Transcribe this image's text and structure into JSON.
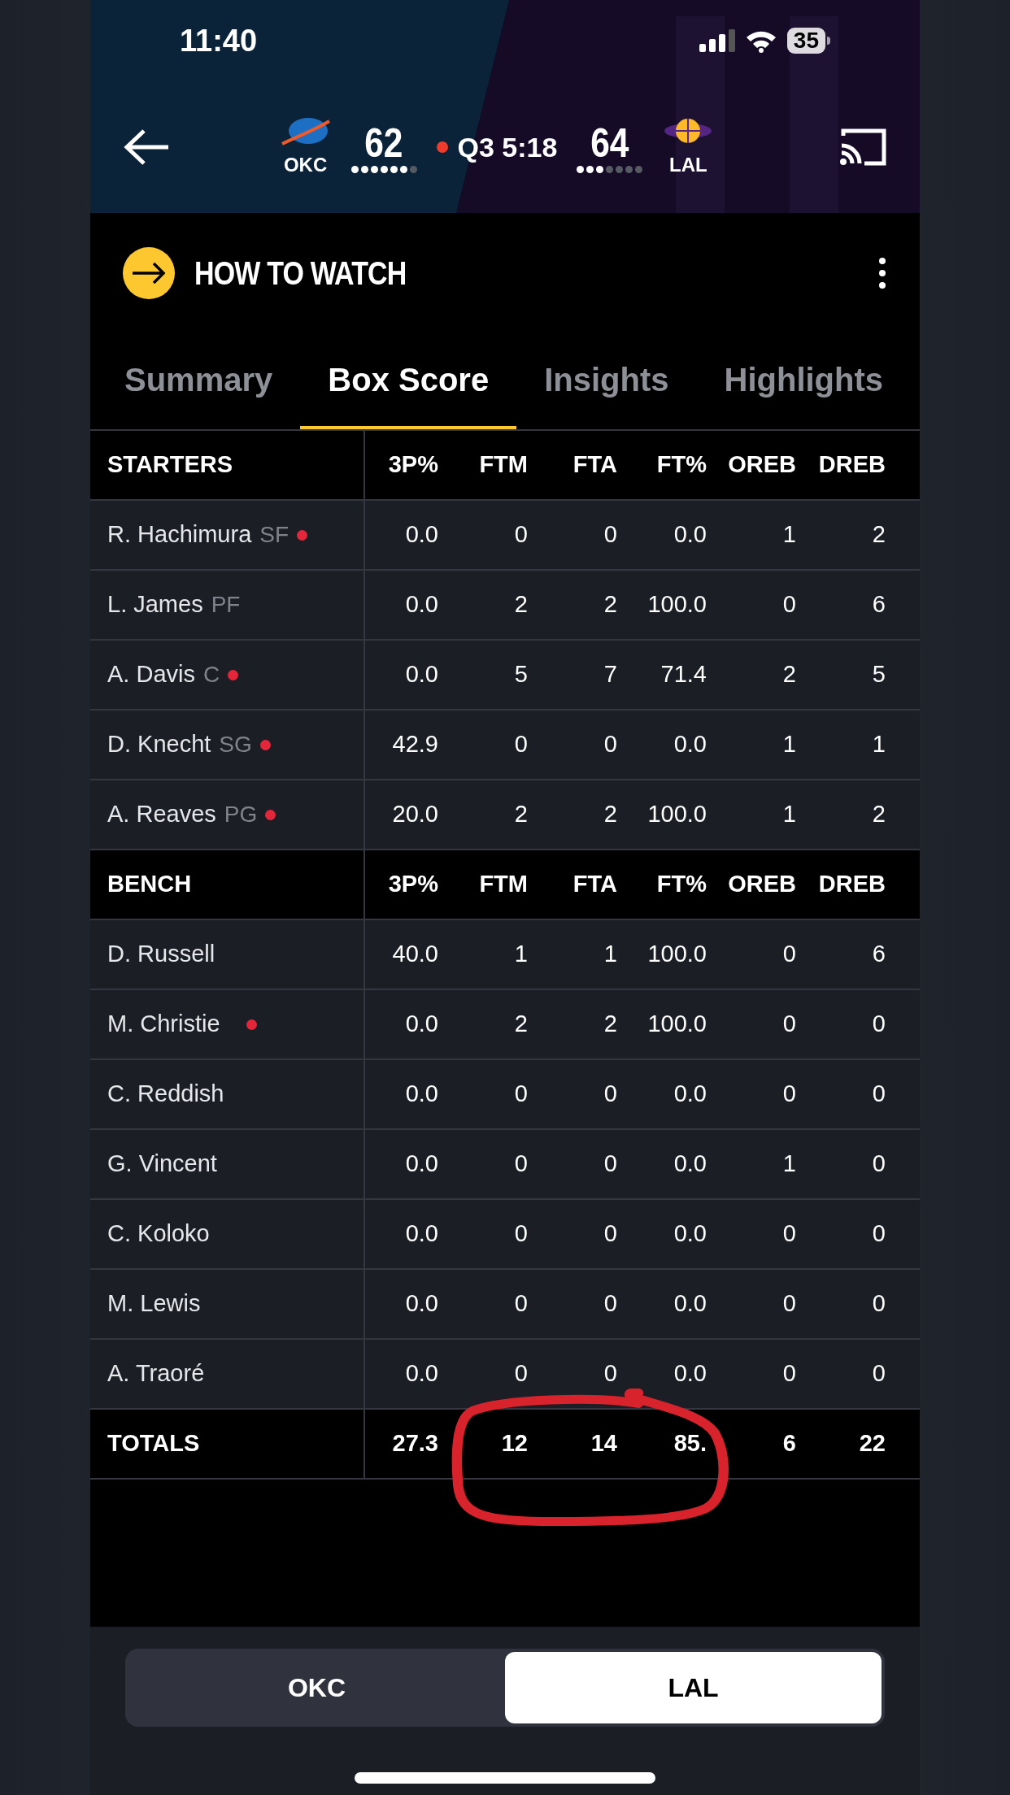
{
  "status_bar": {
    "time": "11:40",
    "battery": "35"
  },
  "scoreboard": {
    "away": {
      "abbr": "OKC",
      "score": "62",
      "timeouts": [
        {
          "remaining": true
        },
        {
          "remaining": true
        },
        {
          "remaining": true
        },
        {
          "remaining": true
        },
        {
          "remaining": true
        },
        {
          "remaining": true
        },
        {
          "remaining": false
        }
      ]
    },
    "home": {
      "abbr": "LAL",
      "score": "64",
      "timeouts": [
        {
          "remaining": true
        },
        {
          "remaining": true
        },
        {
          "remaining": true
        },
        {
          "remaining": false
        },
        {
          "remaining": false
        },
        {
          "remaining": false
        },
        {
          "remaining": false
        }
      ]
    },
    "live": true,
    "clock": "Q3 5:18"
  },
  "banner": {
    "title": "HOW TO WATCH"
  },
  "tabs": [
    {
      "label": "Summary",
      "selected": false
    },
    {
      "label": "Box Score",
      "selected": true
    },
    {
      "label": "Insights",
      "selected": false
    },
    {
      "label": "Highlights",
      "selected": false
    }
  ],
  "sections": [
    {
      "title": "STARTERS",
      "columns": [
        "3P%",
        "FTM",
        "FTA",
        "FT%",
        "OREB",
        "DREB"
      ],
      "rows": [
        {
          "name": "R. Hachimura",
          "position": "SF",
          "on_court": true,
          "stats": [
            "0.0",
            "0",
            "0",
            "0.0",
            "1",
            "2"
          ]
        },
        {
          "name": "L. James",
          "position": "PF",
          "on_court": false,
          "stats": [
            "0.0",
            "2",
            "2",
            "100.0",
            "0",
            "6"
          ]
        },
        {
          "name": "A. Davis",
          "position": "C",
          "on_court": true,
          "stats": [
            "0.0",
            "5",
            "7",
            "71.4",
            "2",
            "5"
          ]
        },
        {
          "name": "D. Knecht",
          "position": "SG",
          "on_court": true,
          "stats": [
            "42.9",
            "0",
            "0",
            "0.0",
            "1",
            "1"
          ]
        },
        {
          "name": "A. Reaves",
          "position": "PG",
          "on_court": true,
          "stats": [
            "20.0",
            "2",
            "2",
            "100.0",
            "1",
            "2"
          ]
        }
      ]
    },
    {
      "title": "BENCH",
      "columns": [
        "3P%",
        "FTM",
        "FTA",
        "FT%",
        "OREB",
        "DREB"
      ],
      "rows": [
        {
          "name": "D. Russell",
          "on_court": false,
          "stats": [
            "40.0",
            "1",
            "1",
            "100.0",
            "0",
            "6"
          ]
        },
        {
          "name": "M. Christie",
          "on_court": true,
          "stats": [
            "0.0",
            "2",
            "2",
            "100.0",
            "0",
            "0"
          ]
        },
        {
          "name": "C. Reddish",
          "on_court": false,
          "stats": [
            "0.0",
            "0",
            "0",
            "0.0",
            "0",
            "0"
          ]
        },
        {
          "name": "G. Vincent",
          "on_court": false,
          "stats": [
            "0.0",
            "0",
            "0",
            "0.0",
            "1",
            "0"
          ]
        },
        {
          "name": "C. Koloko",
          "on_court": false,
          "stats": [
            "0.0",
            "0",
            "0",
            "0.0",
            "0",
            "0"
          ]
        },
        {
          "name": "M. Lewis",
          "on_court": false,
          "stats": [
            "0.0",
            "0",
            "0",
            "0.0",
            "0",
            "0"
          ]
        },
        {
          "name": "A. Traoré",
          "on_court": false,
          "stats": [
            "0.0",
            "0",
            "0",
            "0.0",
            "0",
            "0"
          ]
        }
      ]
    }
  ],
  "totals": {
    "label": "TOTALS",
    "stats": [
      "27.3",
      "12",
      "14",
      "85.",
      "6",
      "22"
    ]
  },
  "team_toggle": [
    {
      "label": "OKC",
      "selected": false
    },
    {
      "label": "LAL",
      "selected": true
    }
  ]
}
